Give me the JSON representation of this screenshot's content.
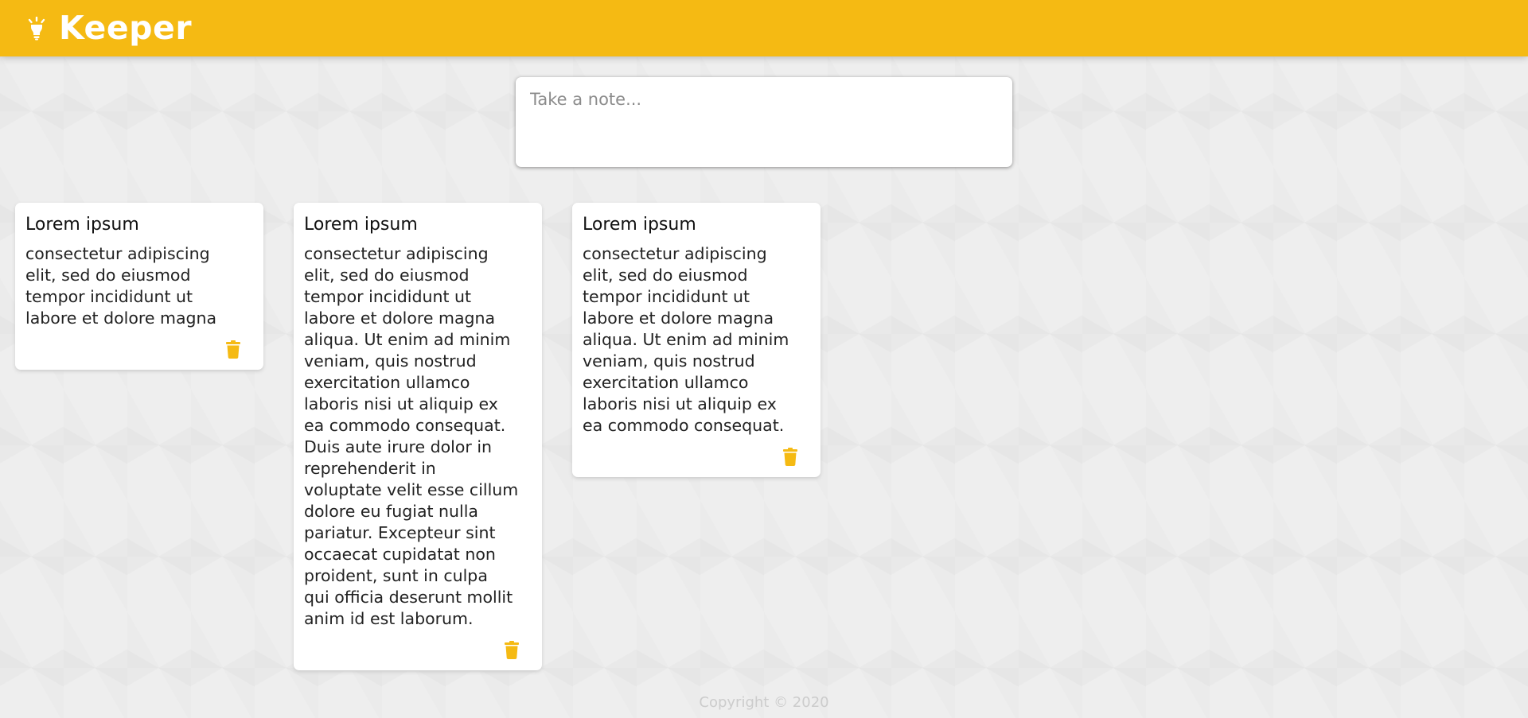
{
  "header": {
    "title": "Keeper",
    "logo_icon": "lightbulb-icon",
    "accent_color": "#f5ba13"
  },
  "create_note": {
    "placeholder": "Take a note..."
  },
  "notes": [
    {
      "title": "Lorem ipsum",
      "content": "consectetur adipiscing\nelit, sed do eiusmod\ntempor incididunt ut\nlabore et dolore magna",
      "delete_icon": "trash-icon"
    },
    {
      "title": "Lorem ipsum",
      "content": "consectetur adipiscing\nelit, sed do eiusmod\ntempor incididunt ut\nlabore et dolore magna\naliqua. Ut enim ad minim\nveniam, quis nostrud\nexercitation ullamco\nlaboris nisi ut aliquip ex\nea commodo consequat.\nDuis aute irure dolor in\nreprehenderit in\nvoluptate velit esse cillum\ndolore eu fugiat nulla\npariatur. Excepteur sint\noccaecat cupidatat non\nproident, sunt in culpa\nqui officia deserunt mollit\nanim id est laborum.",
      "delete_icon": "trash-icon"
    },
    {
      "title": "Lorem ipsum",
      "content": "consectetur adipiscing\nelit, sed do eiusmod\ntempor incididunt ut\nlabore et dolore magna\naliqua. Ut enim ad minim\nveniam, quis nostrud\nexercitation ullamco\nlaboris nisi ut aliquip ex\nea commodo consequat.",
      "delete_icon": "trash-icon"
    }
  ],
  "footer": {
    "copyright": "Copyright © 2020"
  }
}
